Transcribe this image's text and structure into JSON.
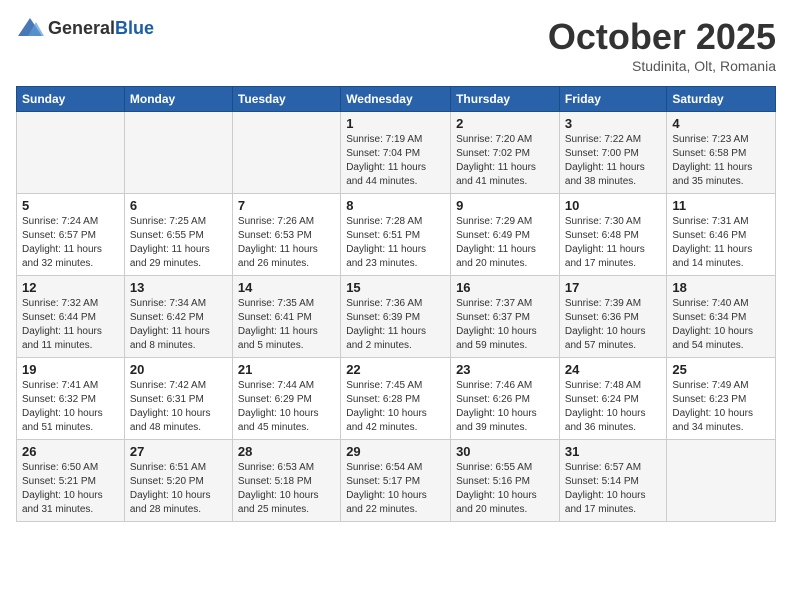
{
  "header": {
    "logo_general": "General",
    "logo_blue": "Blue",
    "month": "October 2025",
    "location": "Studinita, Olt, Romania"
  },
  "days_of_week": [
    "Sunday",
    "Monday",
    "Tuesday",
    "Wednesday",
    "Thursday",
    "Friday",
    "Saturday"
  ],
  "weeks": [
    [
      {
        "day": "",
        "info": ""
      },
      {
        "day": "",
        "info": ""
      },
      {
        "day": "",
        "info": ""
      },
      {
        "day": "1",
        "info": "Sunrise: 7:19 AM\nSunset: 7:04 PM\nDaylight: 11 hours and 44 minutes."
      },
      {
        "day": "2",
        "info": "Sunrise: 7:20 AM\nSunset: 7:02 PM\nDaylight: 11 hours and 41 minutes."
      },
      {
        "day": "3",
        "info": "Sunrise: 7:22 AM\nSunset: 7:00 PM\nDaylight: 11 hours and 38 minutes."
      },
      {
        "day": "4",
        "info": "Sunrise: 7:23 AM\nSunset: 6:58 PM\nDaylight: 11 hours and 35 minutes."
      }
    ],
    [
      {
        "day": "5",
        "info": "Sunrise: 7:24 AM\nSunset: 6:57 PM\nDaylight: 11 hours and 32 minutes."
      },
      {
        "day": "6",
        "info": "Sunrise: 7:25 AM\nSunset: 6:55 PM\nDaylight: 11 hours and 29 minutes."
      },
      {
        "day": "7",
        "info": "Sunrise: 7:26 AM\nSunset: 6:53 PM\nDaylight: 11 hours and 26 minutes."
      },
      {
        "day": "8",
        "info": "Sunrise: 7:28 AM\nSunset: 6:51 PM\nDaylight: 11 hours and 23 minutes."
      },
      {
        "day": "9",
        "info": "Sunrise: 7:29 AM\nSunset: 6:49 PM\nDaylight: 11 hours and 20 minutes."
      },
      {
        "day": "10",
        "info": "Sunrise: 7:30 AM\nSunset: 6:48 PM\nDaylight: 11 hours and 17 minutes."
      },
      {
        "day": "11",
        "info": "Sunrise: 7:31 AM\nSunset: 6:46 PM\nDaylight: 11 hours and 14 minutes."
      }
    ],
    [
      {
        "day": "12",
        "info": "Sunrise: 7:32 AM\nSunset: 6:44 PM\nDaylight: 11 hours and 11 minutes."
      },
      {
        "day": "13",
        "info": "Sunrise: 7:34 AM\nSunset: 6:42 PM\nDaylight: 11 hours and 8 minutes."
      },
      {
        "day": "14",
        "info": "Sunrise: 7:35 AM\nSunset: 6:41 PM\nDaylight: 11 hours and 5 minutes."
      },
      {
        "day": "15",
        "info": "Sunrise: 7:36 AM\nSunset: 6:39 PM\nDaylight: 11 hours and 2 minutes."
      },
      {
        "day": "16",
        "info": "Sunrise: 7:37 AM\nSunset: 6:37 PM\nDaylight: 10 hours and 59 minutes."
      },
      {
        "day": "17",
        "info": "Sunrise: 7:39 AM\nSunset: 6:36 PM\nDaylight: 10 hours and 57 minutes."
      },
      {
        "day": "18",
        "info": "Sunrise: 7:40 AM\nSunset: 6:34 PM\nDaylight: 10 hours and 54 minutes."
      }
    ],
    [
      {
        "day": "19",
        "info": "Sunrise: 7:41 AM\nSunset: 6:32 PM\nDaylight: 10 hours and 51 minutes."
      },
      {
        "day": "20",
        "info": "Sunrise: 7:42 AM\nSunset: 6:31 PM\nDaylight: 10 hours and 48 minutes."
      },
      {
        "day": "21",
        "info": "Sunrise: 7:44 AM\nSunset: 6:29 PM\nDaylight: 10 hours and 45 minutes."
      },
      {
        "day": "22",
        "info": "Sunrise: 7:45 AM\nSunset: 6:28 PM\nDaylight: 10 hours and 42 minutes."
      },
      {
        "day": "23",
        "info": "Sunrise: 7:46 AM\nSunset: 6:26 PM\nDaylight: 10 hours and 39 minutes."
      },
      {
        "day": "24",
        "info": "Sunrise: 7:48 AM\nSunset: 6:24 PM\nDaylight: 10 hours and 36 minutes."
      },
      {
        "day": "25",
        "info": "Sunrise: 7:49 AM\nSunset: 6:23 PM\nDaylight: 10 hours and 34 minutes."
      }
    ],
    [
      {
        "day": "26",
        "info": "Sunrise: 6:50 AM\nSunset: 5:21 PM\nDaylight: 10 hours and 31 minutes."
      },
      {
        "day": "27",
        "info": "Sunrise: 6:51 AM\nSunset: 5:20 PM\nDaylight: 10 hours and 28 minutes."
      },
      {
        "day": "28",
        "info": "Sunrise: 6:53 AM\nSunset: 5:18 PM\nDaylight: 10 hours and 25 minutes."
      },
      {
        "day": "29",
        "info": "Sunrise: 6:54 AM\nSunset: 5:17 PM\nDaylight: 10 hours and 22 minutes."
      },
      {
        "day": "30",
        "info": "Sunrise: 6:55 AM\nSunset: 5:16 PM\nDaylight: 10 hours and 20 minutes."
      },
      {
        "day": "31",
        "info": "Sunrise: 6:57 AM\nSunset: 5:14 PM\nDaylight: 10 hours and 17 minutes."
      },
      {
        "day": "",
        "info": ""
      }
    ]
  ]
}
